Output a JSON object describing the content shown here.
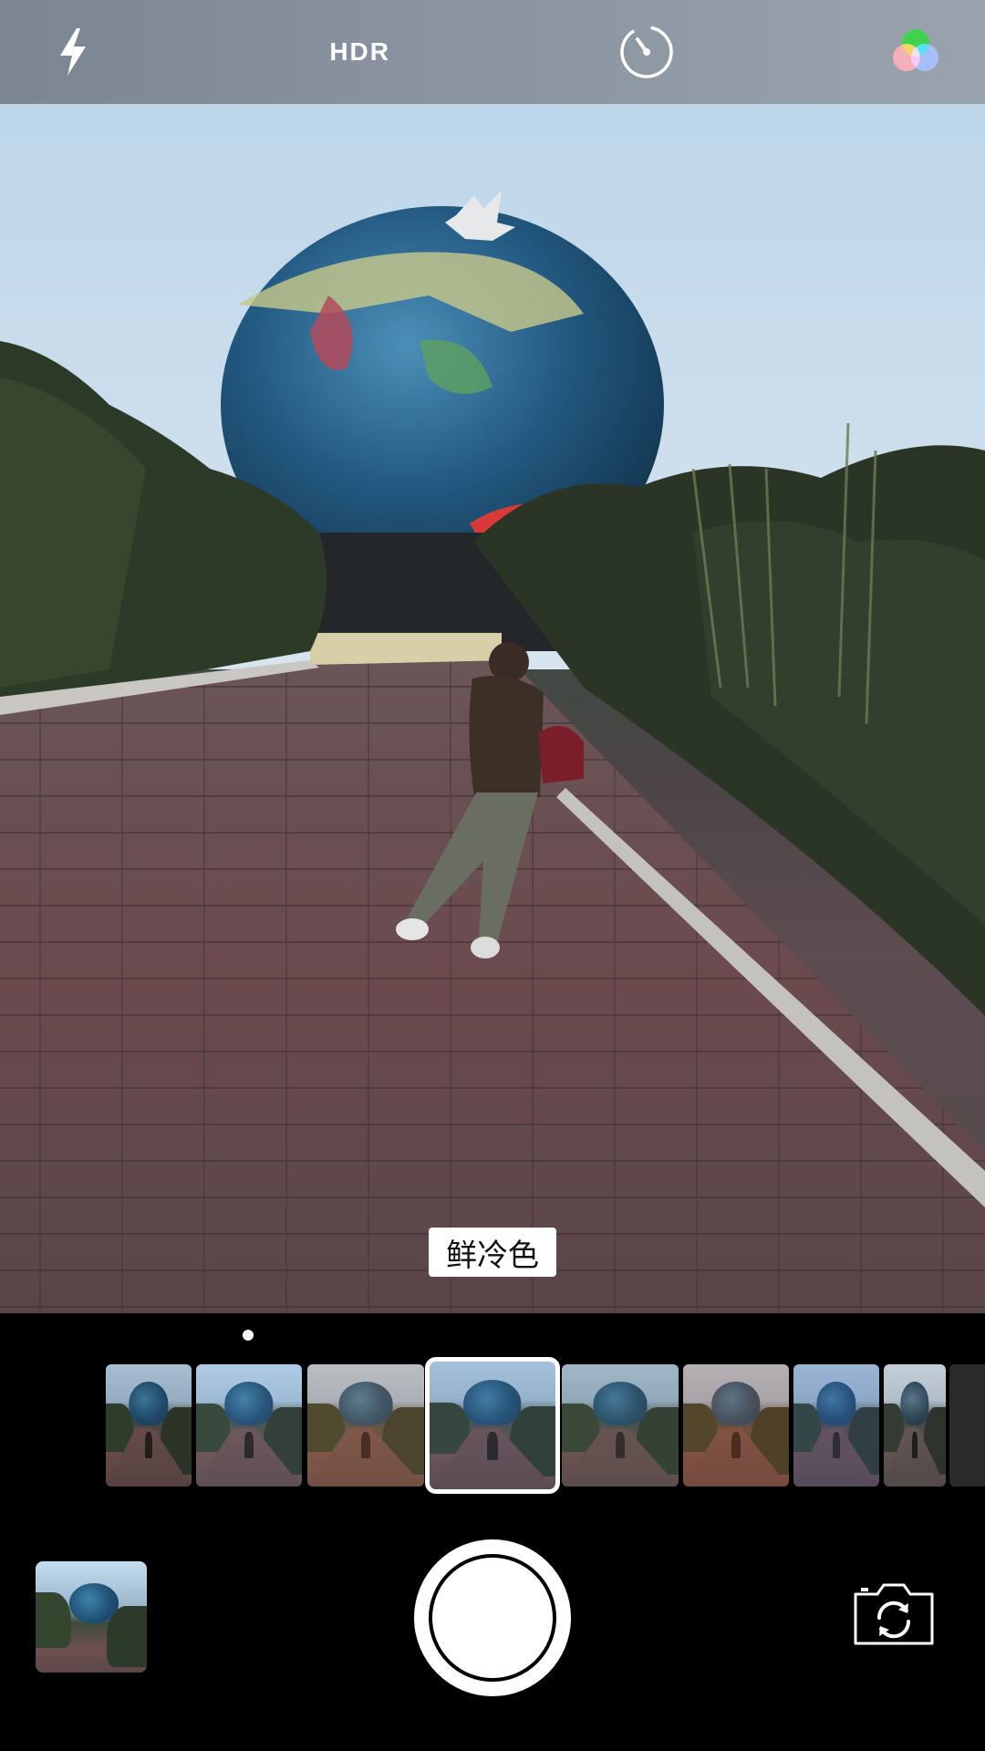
{
  "top_bar": {
    "flash_icon": "flash-bolt-icon",
    "hdr_label": "HDR",
    "timer_icon": "timer-icon",
    "filters_icon": "filters-icon"
  },
  "viewfinder": {
    "filter_name": "鲜冷色"
  },
  "filmstrip": {
    "thumbnail_count": 9,
    "selected_index": 3,
    "page_indicator_dots": 1
  },
  "controls": {
    "last_photo_icon": "photo-thumbnail",
    "shutter_icon": "shutter-button",
    "switch_camera_icon": "camera-flip-icon"
  },
  "colors": {
    "top_bar": "#8893a0",
    "selection_border": "#ffffff",
    "background": "#000000"
  }
}
